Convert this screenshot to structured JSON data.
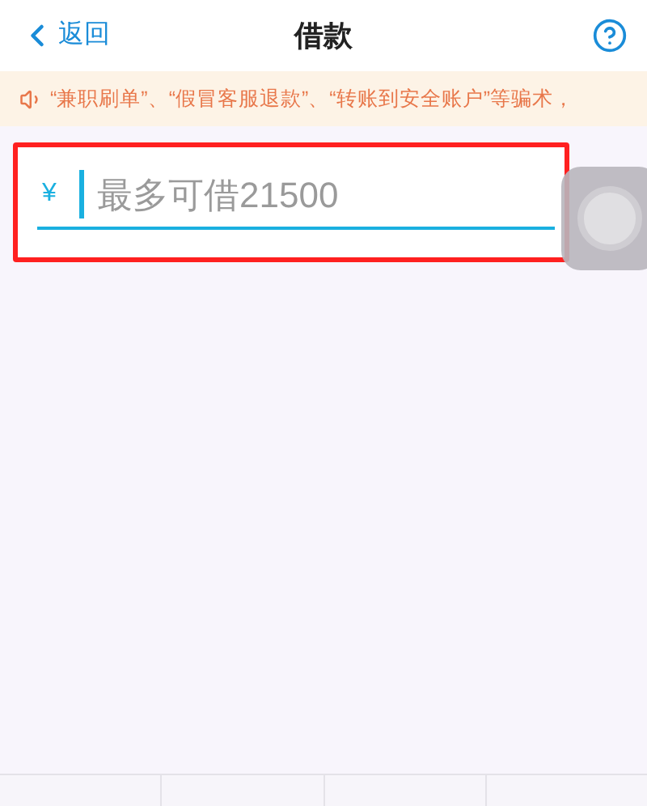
{
  "nav": {
    "back": "返回",
    "title": "借款"
  },
  "notice": "“兼职刷单”、“假冒客服退款”、“转账到安全账户”等骗术，",
  "amount": {
    "currency": "¥",
    "placeholder": "最多可借21500"
  },
  "highlight": true
}
